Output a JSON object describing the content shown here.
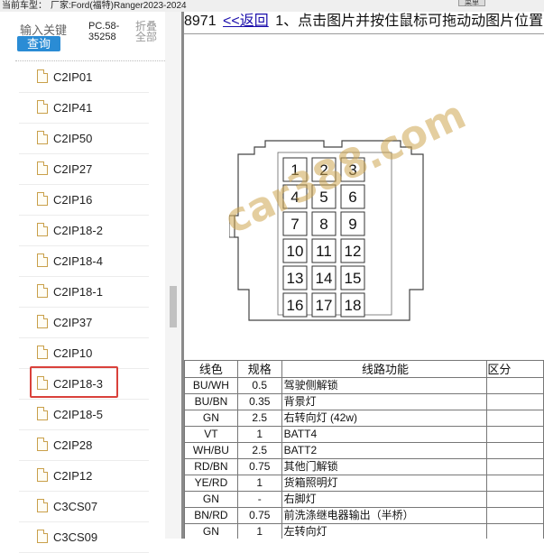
{
  "topbar": {
    "current_model_label": "当前车型：",
    "manufacturer": "厂家:Ford(福特)Ranger2023-2024",
    "button_label": "菜单"
  },
  "sidebar": {
    "search_label": "输入关键",
    "search_button": "查询",
    "pc_code": "PC.58-35258",
    "fold_all": "折叠全部",
    "items": [
      {
        "label": "C2IP01"
      },
      {
        "label": "C2IP41"
      },
      {
        "label": "C2IP50"
      },
      {
        "label": "C2IP27"
      },
      {
        "label": "C2IP16"
      },
      {
        "label": "C2IP18-2"
      },
      {
        "label": "C2IP18-4"
      },
      {
        "label": "C2IP18-1"
      },
      {
        "label": "C2IP37"
      },
      {
        "label": "C2IP10"
      },
      {
        "label": "C2IP18-3",
        "selected": true
      },
      {
        "label": "C2IP18-5"
      },
      {
        "label": "C2IP28"
      },
      {
        "label": "C2IP12"
      },
      {
        "label": "C3CS07"
      },
      {
        "label": "C3CS09"
      }
    ]
  },
  "main": {
    "part_prefix": "8971",
    "back_link": "<<返回",
    "instruction": "1、点击图片并按住鼠标可拖动动图片位置",
    "watermark": "car388.com",
    "connector": {
      "pins": [
        [
          1,
          2,
          3
        ],
        [
          4,
          5,
          6
        ],
        [
          7,
          8,
          9
        ],
        [
          10,
          11,
          12
        ],
        [
          13,
          14,
          15
        ],
        [
          16,
          17,
          18
        ]
      ]
    },
    "table": {
      "headers": {
        "color": "线色",
        "spec": "规格",
        "function": "线路功能",
        "distinction": "区分"
      },
      "rows": [
        {
          "color": "BU/WH",
          "spec": "0.5",
          "function": "驾驶侧解锁"
        },
        {
          "color": "BU/BN",
          "spec": "0.35",
          "function": "背景灯"
        },
        {
          "color": "GN",
          "spec": "2.5",
          "function": "右转向灯 (42w)"
        },
        {
          "color": "VT",
          "spec": "1",
          "function": "BATT4"
        },
        {
          "color": "WH/BU",
          "spec": "2.5",
          "function": "BATT2"
        },
        {
          "color": "RD/BN",
          "spec": "0.75",
          "function": "其他门解锁"
        },
        {
          "color": "YE/RD",
          "spec": "1",
          "function": "货箱照明灯"
        },
        {
          "color": "GN",
          "spec": "-",
          "function": "右脚灯"
        },
        {
          "color": "BN/RD",
          "spec": "0.75",
          "function": "前洗涤继电器输出（半桥）"
        },
        {
          "color": "GN",
          "spec": "1",
          "function": "左转向灯"
        }
      ]
    }
  }
}
